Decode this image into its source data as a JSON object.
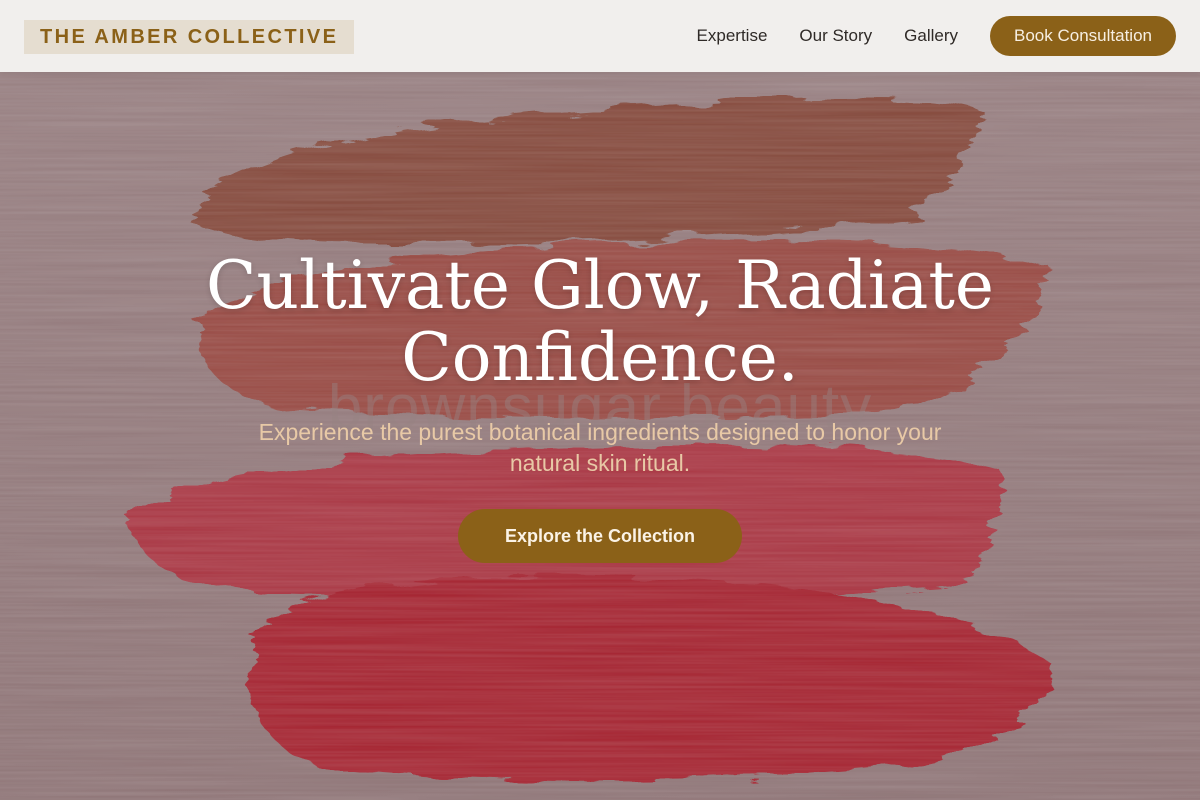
{
  "header": {
    "brand": "THE AMBER COLLECTIVE",
    "nav": [
      {
        "label": "Expertise"
      },
      {
        "label": "Our Story"
      },
      {
        "label": "Gallery"
      }
    ],
    "cta_label": "Book Consultation"
  },
  "hero": {
    "title_line1": "Cultivate Glow, Radiate",
    "title_line2": "Confidence.",
    "watermark": "brownsugar beauty",
    "subtitle_line1": "Experience the purest botanical ingredients designed to honor your",
    "subtitle_line2": "natural skin ritual.",
    "cta_label": "Explore the Collection"
  },
  "colors": {
    "accent": "#8b6118",
    "header_bg": "#f1efed",
    "hero_bg": "#9b8384",
    "swatch_bronze": "#8a4a37",
    "swatch_terracotta": "#a0483f",
    "swatch_rose": "#b5303f",
    "swatch_crimson": "#b01e2a",
    "subtitle": "#e8c9a6"
  }
}
